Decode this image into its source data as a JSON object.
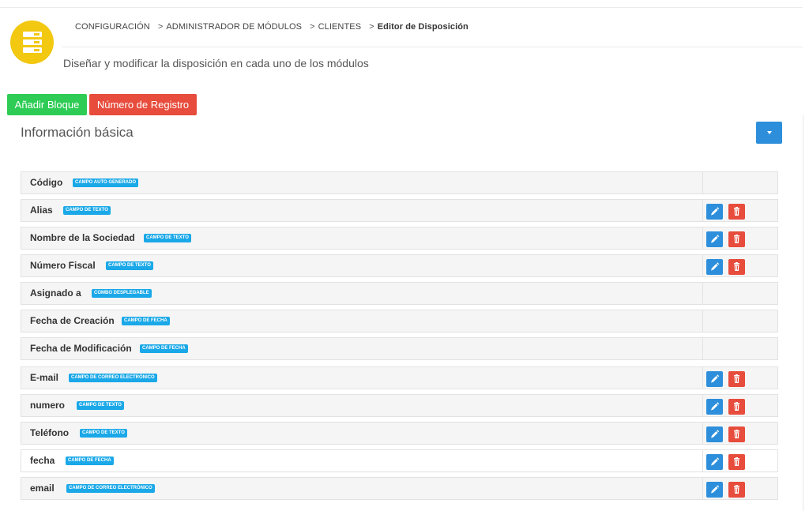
{
  "breadcrumb": {
    "items": [
      "CONFIGURACIÓN",
      "ADMINISTRADOR DE MÓDULOS",
      "CLIENTES",
      "Editor de Disposición"
    ],
    "separator": ">"
  },
  "header": {
    "subtitle": "Diseñar y modificar la disposición en cada uno de los módulos"
  },
  "toolbar": {
    "add_block_label": "Añadir Bloque",
    "record_number_label": "Número de Registro"
  },
  "block": {
    "title": "Información básica",
    "fields": [
      {
        "label": "Código",
        "tag": "CAMPO AUTO GENERADO"
      },
      {
        "label": "Alias",
        "tag": "CAMPO DE TEXTO"
      },
      {
        "label": "Nombre de la Sociedad",
        "tag": "CAMPO DE TEXTO"
      },
      {
        "label": "Número Fiscal",
        "tag": "CAMPO DE TEXTO"
      },
      {
        "label": "Asignado a",
        "tag": "COMBO DESPLEGABLE"
      },
      {
        "label": "Fecha de Creación",
        "tag": "CAMPO DE FECHA"
      },
      {
        "label": "Fecha de Modificación",
        "tag": "CAMPO DE FECHA"
      },
      {
        "label": "E-mail",
        "tag": "CAMPO DE CORREO ELECTRÓNICO"
      },
      {
        "label": "numero",
        "tag": "CAMPO DE TEXTO"
      },
      {
        "label": "Teléfono",
        "tag": "CAMPO DE TEXTO"
      },
      {
        "label": "fecha",
        "tag": "CAMPO DE FECHA"
      },
      {
        "label": "email",
        "tag": "CAMPO DE CORREO ELECTRÓNICO"
      }
    ]
  },
  "colors": {
    "accent_blue": "#2d8fdc",
    "add_green": "#2ecc55",
    "danger_red": "#e74c3c",
    "tag_blue": "#1aa8e8",
    "module_icon_yellow": "#f2c811"
  },
  "icons": {
    "module": "server-stack-icon",
    "dropdown": "caret-down-icon",
    "edit": "pencil-icon",
    "delete": "trash-icon"
  }
}
